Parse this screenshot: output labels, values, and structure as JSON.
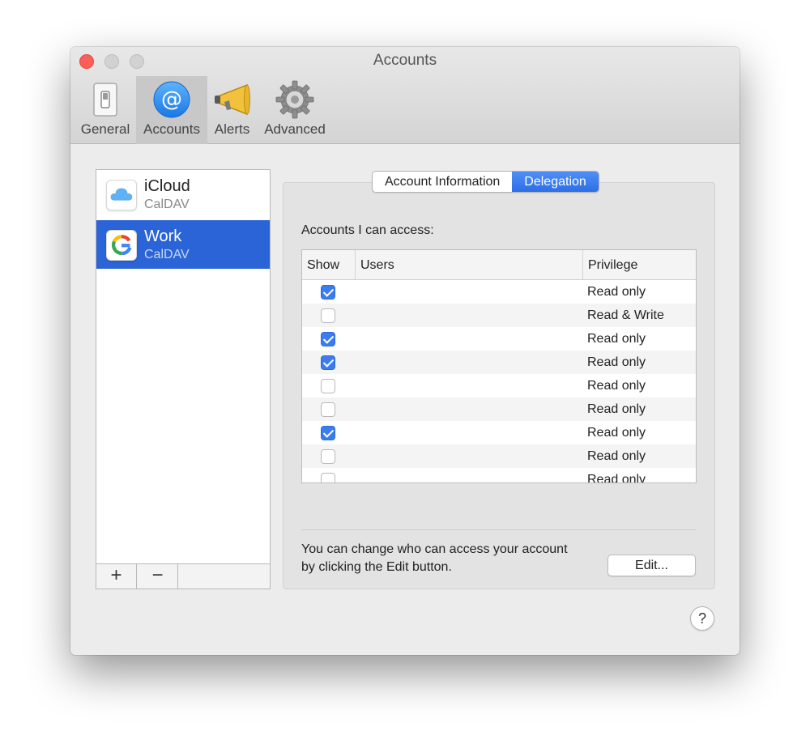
{
  "window": {
    "title": "Accounts"
  },
  "toolbar": {
    "items": [
      {
        "label": "General",
        "icon": "switch-icon"
      },
      {
        "label": "Accounts",
        "icon": "at-sign-icon",
        "active": true
      },
      {
        "label": "Alerts",
        "icon": "megaphone-icon"
      },
      {
        "label": "Advanced",
        "icon": "gear-icon"
      }
    ]
  },
  "sidebar": {
    "accounts": [
      {
        "name": "iCloud",
        "type": "CalDAV",
        "icon": "icloud-icon"
      },
      {
        "name": "Work",
        "type": "CalDAV",
        "icon": "google-icon",
        "selected": true
      }
    ],
    "add_label": "+",
    "remove_label": "−"
  },
  "tabs": [
    {
      "label": "Account Information"
    },
    {
      "label": "Delegation",
      "selected": true
    }
  ],
  "delegation": {
    "section_label": "Accounts I can access:",
    "columns": {
      "show": "Show",
      "users": "Users",
      "privilege": "Privilege"
    },
    "rows": [
      {
        "show": true,
        "privilege": "Read only"
      },
      {
        "show": false,
        "privilege": "Read & Write"
      },
      {
        "show": true,
        "privilege": "Read only"
      },
      {
        "show": true,
        "privilege": "Read only"
      },
      {
        "show": false,
        "privilege": "Read only"
      },
      {
        "show": false,
        "privilege": "Read only"
      },
      {
        "show": true,
        "privilege": "Read only"
      },
      {
        "show": false,
        "privilege": "Read only"
      },
      {
        "show": false,
        "privilege": "Read only"
      }
    ],
    "help_text": "You can change who can access your account by clicking the Edit button.",
    "edit_label": "Edit...",
    "help_label": "?"
  },
  "colors": {
    "accent": "#2a64d6",
    "close": "#fc5f57",
    "checkbox": "#3b7cf0"
  }
}
